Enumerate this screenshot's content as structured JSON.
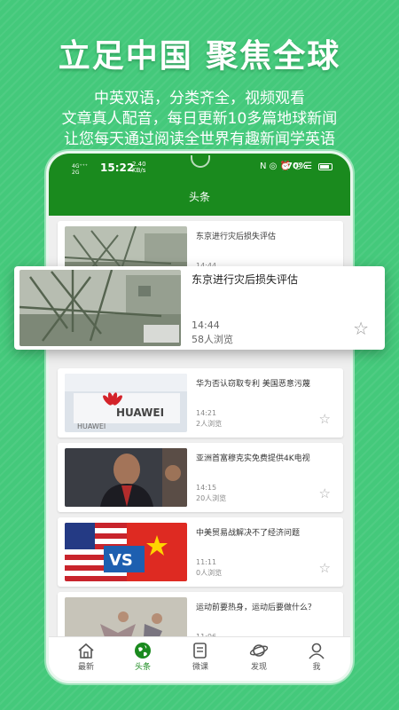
{
  "promo": {
    "headline": "立足中国 聚焦全球",
    "line1": "中英双语，分类齐全，视频观看",
    "line2": "文章真人配音，每日更新10多篇地球新闻",
    "line3": "让您每天通过阅读全世界有趣新闻学英语"
  },
  "status_bar": {
    "signal_top": "4G⁺⁺⁺",
    "signal_bottom": "2G",
    "time": "15:22",
    "rate_value": "2.40",
    "rate_unit": "KB/s",
    "icons": "N ◎ ⏰ ◷ ☰",
    "battery": "70%"
  },
  "header": {
    "title": "头条"
  },
  "featured": {
    "title": "东京进行灾后损失评估",
    "time": "14:44",
    "views": "58人浏览",
    "thumbnail": "damaged-building-scaffold"
  },
  "articles": [
    {
      "title": "东京进行灾后损失评估",
      "time": "14:44",
      "views": "",
      "thumbnail": "damaged-building-scaffold"
    },
    {
      "title": "华为否认窃取专利 美国恶意污蔑",
      "time": "14:21",
      "views": "2人浏览",
      "thumbnail": "huawei-logo-sign"
    },
    {
      "title": "亚洲首富穆克实免费提供4K电视",
      "time": "14:15",
      "views": "20人浏览",
      "thumbnail": "businessman-portrait"
    },
    {
      "title": "中美贸易战解决不了经济问题",
      "time": "11:11",
      "views": "0人浏览",
      "thumbnail": "us-vs-china-flags"
    },
    {
      "title": "运动前要热身，运动后要做什么？",
      "time": "11:06",
      "views": "",
      "thumbnail": "people-stretching"
    }
  ],
  "tabs": [
    {
      "label": "最新",
      "icon": "home-icon"
    },
    {
      "label": "头条",
      "icon": "globe-icon",
      "active": true
    },
    {
      "label": "微课",
      "icon": "book-icon"
    },
    {
      "label": "发现",
      "icon": "planet-icon"
    },
    {
      "label": "我",
      "icon": "person-icon"
    }
  ],
  "colors": {
    "brand_green": "#1a8a1e",
    "background": "#44c97b"
  },
  "thumb_text": {
    "huawei": "HUAWEI",
    "vs": "VS"
  }
}
